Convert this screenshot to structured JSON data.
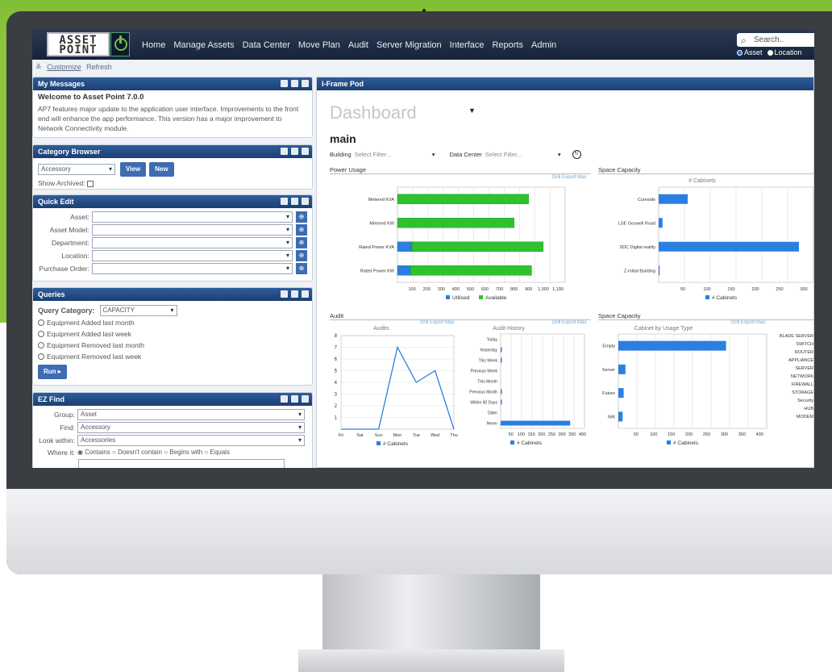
{
  "app": {
    "logo_line1": "ASSET",
    "logo_line2": "POINT"
  },
  "nav": [
    "Home",
    "Manage Assets",
    "Data Center",
    "Move Plan",
    "Audit",
    "Server Migration",
    "Interface",
    "Reports",
    "Admin"
  ],
  "search": {
    "placeholder": "Search..",
    "options": [
      "Asset",
      "Location"
    ]
  },
  "toolbar": {
    "customize": "Customize",
    "refresh": "Refresh"
  },
  "messages": {
    "title": "My Messages",
    "heading": "Welcome to Asset Point 7.0.0",
    "body": "AP7 features major update to the application user interface. Improvements to the front end will enhance the app performance. This version has a major improvement to Network Connectivity module."
  },
  "category": {
    "title": "Category Browser",
    "value": "Accessory",
    "view": "View",
    "new": "New",
    "archived": "Show Archived:"
  },
  "quickedit": {
    "title": "Quick Edit",
    "fields": [
      "Asset:",
      "Asset Model:",
      "Department:",
      "Location:",
      "Purchase Order:"
    ]
  },
  "queries": {
    "title": "Queries",
    "category_label": "Query Category:",
    "category_value": "CAPACITY",
    "options": [
      "Equipment Added last month",
      "Equipment Added last week",
      "Equipment Removed last month",
      "Equipment Removed last week"
    ],
    "run": "Run"
  },
  "ezfind": {
    "title": "EZ Find",
    "group_label": "Group:",
    "group_value": "Asset",
    "find_label": "Find:",
    "find_value": "Accessory",
    "within_label": "Look within:",
    "within_value": "Accessories",
    "where_label": "Where it:",
    "where_options": [
      "Contains",
      "Doesn't contain",
      "Begins with",
      "Equals"
    ]
  },
  "iframe": {
    "title": "I-Frame Pod",
    "dashboard": "Dashboard",
    "main": "main",
    "building_label": "Building",
    "building_value": "Select Filter...",
    "dc_label": "Data Center",
    "dc_value": "Select Filter...",
    "sec_power": "Power Usage",
    "sec_space": "Space Capacity",
    "sec_audit": "Audit",
    "sec_space2": "Space Capacity",
    "links": {
      "drill": "Drill",
      "export": "Export",
      "max": "Max"
    }
  },
  "chart_data": [
    {
      "type": "bar",
      "title": "",
      "categories": [
        "Metered KVA",
        "Metered KW",
        "Rated Power KVA",
        "Rated Power KW"
      ],
      "series": [
        {
          "name": "Utilised",
          "values": [
            0,
            0,
            100,
            90
          ],
          "color": "#2b7fe0"
        },
        {
          "name": "Available",
          "values": [
            900,
            800,
            900,
            830
          ],
          "color": "#2ec22e"
        }
      ],
      "ticks": [
        "100",
        "200",
        "300",
        "400",
        "500",
        "600",
        "700",
        "800",
        "900",
        "1,000",
        "1,100"
      ],
      "xlim": [
        0,
        1150
      ],
      "orientation": "horizontal",
      "stacked": true
    },
    {
      "type": "bar",
      "title": "# Cabinets",
      "categories": [
        "Cureside",
        "LSE Goswell Road",
        "SDC Digital reality",
        "Z-Initial Building"
      ],
      "values": [
        60,
        8,
        290,
        2
      ],
      "ticks": [
        "50",
        "100",
        "150",
        "200",
        "250",
        "300"
      ],
      "xlim": [
        0,
        320
      ],
      "orientation": "horizontal",
      "legend": "# Cabinets"
    },
    {
      "type": "line",
      "title": "Audits",
      "categories": [
        "Fri",
        "Sat",
        "Sun",
        "Mon",
        "Tue",
        "Wed",
        "Thu"
      ],
      "values": [
        0,
        0,
        0,
        7,
        4,
        5,
        0
      ],
      "yticks": [
        "1",
        "2",
        "3",
        "4",
        "5",
        "6",
        "7",
        "8"
      ],
      "ylim": [
        0,
        8
      ],
      "legend": "# Cabinets"
    },
    {
      "type": "bar",
      "title": "Audit History",
      "categories": [
        "Today",
        "Yesterday",
        "This Week",
        "Previous Week",
        "This Month",
        "Previous Month",
        "Within 90 Days",
        "Older",
        "Never"
      ],
      "values": [
        0,
        2,
        5,
        0,
        0,
        3,
        3,
        0,
        340
      ],
      "ticks": [
        "50",
        "100",
        "150",
        "200",
        "250",
        "300",
        "350",
        "400"
      ],
      "xlim": [
        0,
        410
      ],
      "orientation": "horizontal",
      "legend": "# Cabinets"
    },
    {
      "type": "bar",
      "title": "Cabinet by Usage Type",
      "categories": [
        "Empty",
        "Server",
        "Future",
        "N/K"
      ],
      "values": [
        305,
        20,
        15,
        12
      ],
      "ticks": [
        "50",
        "100",
        "150",
        "200",
        "250",
        "300",
        "350",
        "400"
      ],
      "xlim": [
        0,
        420
      ],
      "orientation": "horizontal",
      "legend": "# Cabinets",
      "side_labels": [
        "BLADE SERVER",
        "SWITCH",
        "ROUTER",
        "APPLIANCE",
        "SERVER",
        "NETWORK",
        "FIREWALL",
        "STORAGE",
        "Security",
        "HUB",
        "MODEM"
      ]
    }
  ]
}
